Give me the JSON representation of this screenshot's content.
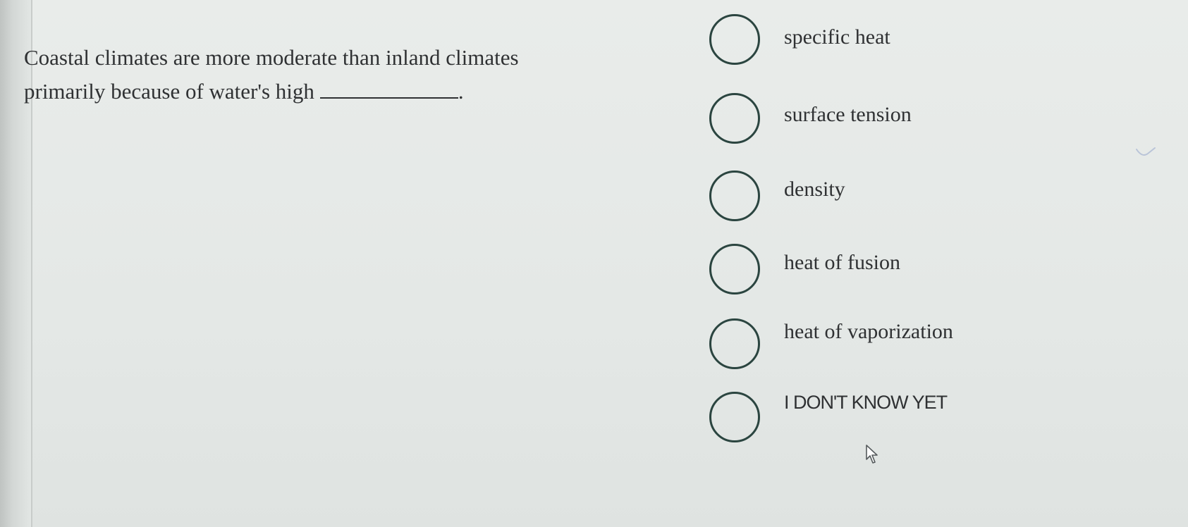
{
  "question": {
    "text_line1": "Coastal climates are more moderate than inland climates",
    "text_line2": "primarily because of water's high",
    "after_blank": "."
  },
  "options": [
    {
      "label": "specific heat"
    },
    {
      "label": "surface tension"
    },
    {
      "label": "density"
    },
    {
      "label": "heat of fusion"
    },
    {
      "label": "heat of vaporization"
    },
    {
      "label": "I DON'T KNOW YET"
    }
  ],
  "colors": {
    "radio_border": "#2b4540",
    "text": "#2f3133",
    "background": "#e6e9e7"
  }
}
